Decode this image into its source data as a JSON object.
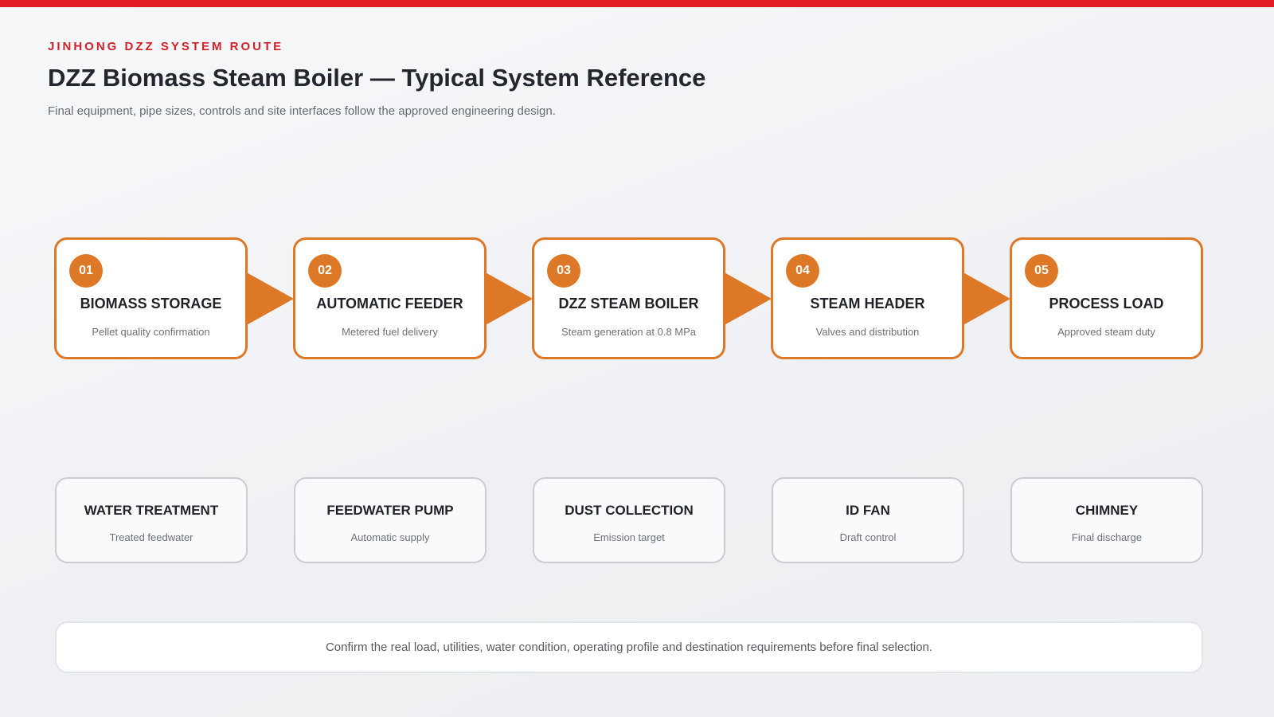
{
  "header": {
    "eyebrow": "JINHONG DZZ SYSTEM ROUTE",
    "title": "DZZ Biomass Steam Boiler — Typical System Reference",
    "subtitle": "Final equipment, pipe sizes, controls and site interfaces follow the approved engineering design."
  },
  "colors": {
    "accent": "#dc7826",
    "brand_red": "#e01b22",
    "aux_border": "#c9cdd2"
  },
  "steps": [
    {
      "num": "01",
      "title": "BIOMASS STORAGE",
      "desc": "Pellet quality confirmation"
    },
    {
      "num": "02",
      "title": "AUTOMATIC FEEDER",
      "desc": "Metered fuel delivery"
    },
    {
      "num": "03",
      "title": "DZZ STEAM BOILER",
      "desc": "Steam generation at 0.8 MPa"
    },
    {
      "num": "04",
      "title": "STEAM HEADER",
      "desc": "Valves and distribution"
    },
    {
      "num": "05",
      "title": "PROCESS LOAD",
      "desc": "Approved steam duty"
    }
  ],
  "auxiliary": [
    {
      "title": "WATER TREATMENT",
      "desc": "Treated feedwater"
    },
    {
      "title": "FEEDWATER PUMP",
      "desc": "Automatic supply"
    },
    {
      "title": "DUST COLLECTION",
      "desc": "Emission target"
    },
    {
      "title": "ID FAN",
      "desc": "Draft control"
    },
    {
      "title": "CHIMNEY",
      "desc": "Final discharge"
    }
  ],
  "note": "Confirm the real load, utilities, water condition, operating profile and destination requirements before final selection."
}
